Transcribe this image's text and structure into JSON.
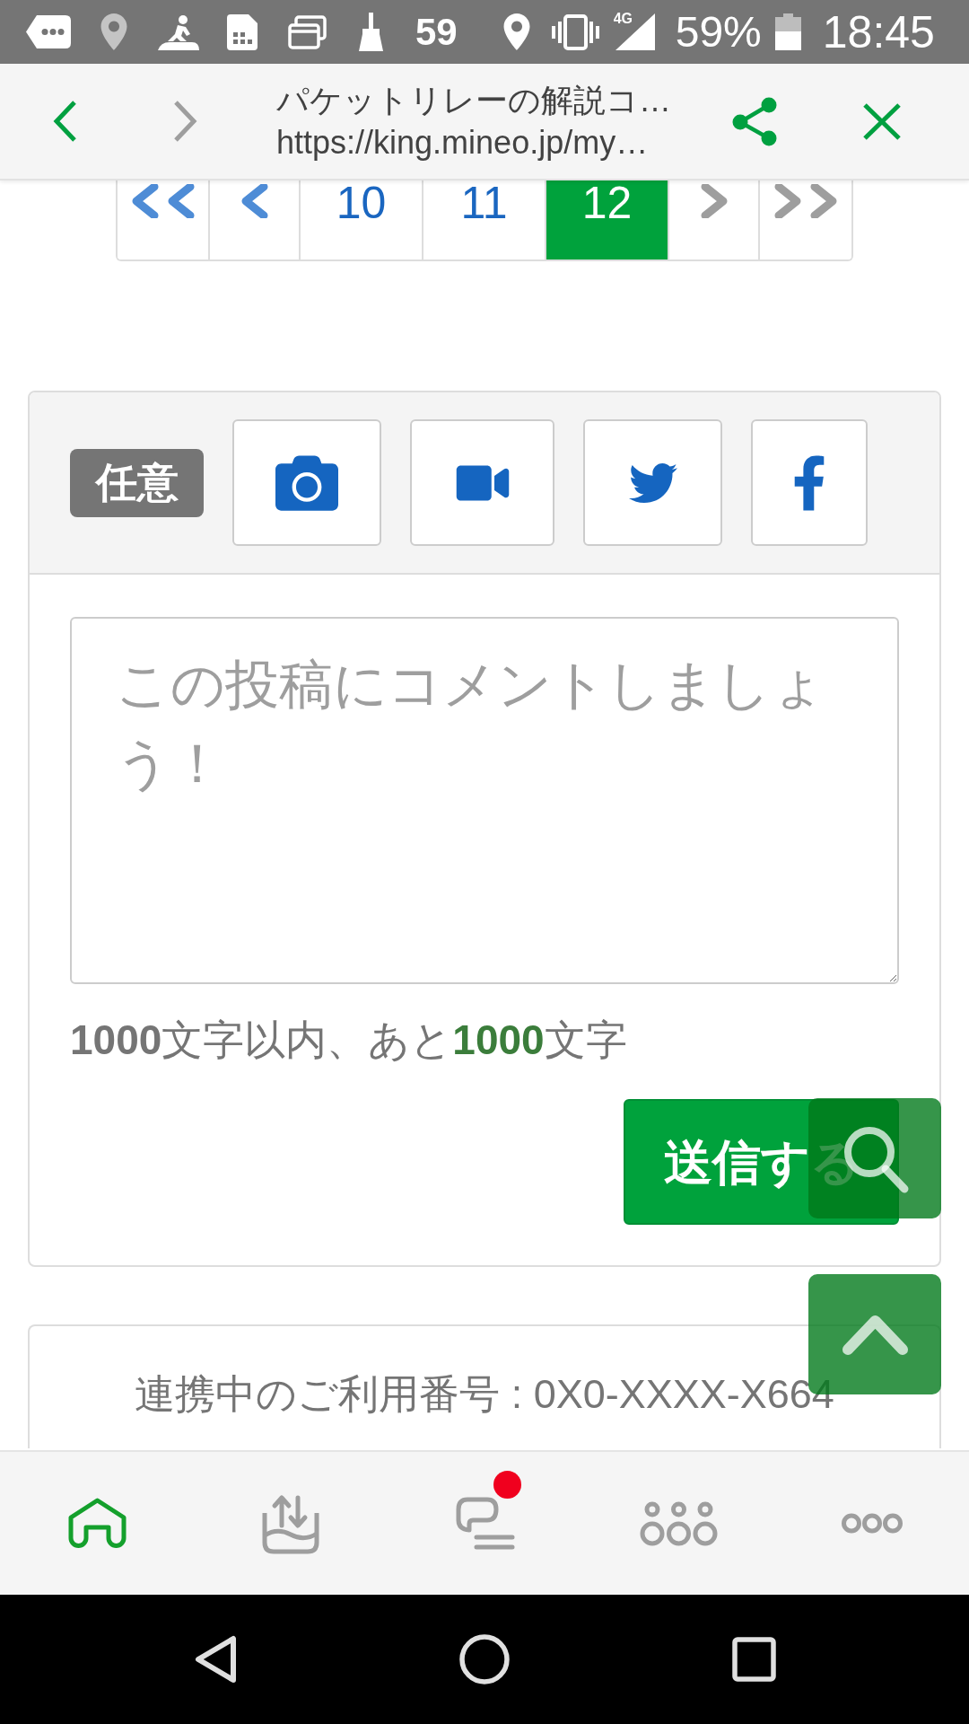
{
  "status_bar": {
    "notification_count": "59",
    "network_type": "4G",
    "battery_percent": "59%",
    "time": "18:45"
  },
  "browser_bar": {
    "nav": [
      {
        "kind": "back",
        "disabled": false
      },
      {
        "kind": "forward",
        "disabled": true
      }
    ],
    "title": "パケットリレーの解説コ…",
    "url": "https://king.mineo.jp/my…"
  },
  "pagination": [
    {
      "kind": "first",
      "disabled": false
    },
    {
      "kind": "prev",
      "disabled": false
    },
    {
      "kind": "page",
      "label": "10",
      "selected": false
    },
    {
      "kind": "page",
      "label": "11",
      "selected": false
    },
    {
      "kind": "page",
      "label": "12",
      "selected": true
    },
    {
      "kind": "next",
      "disabled": true
    },
    {
      "kind": "last",
      "disabled": true
    }
  ],
  "attachments": {
    "badge": "任意",
    "buttons": [
      {
        "kind": "camera"
      },
      {
        "kind": "video"
      },
      {
        "kind": "twitter"
      },
      {
        "kind": "facebook"
      }
    ]
  },
  "comment_form": {
    "placeholder": "この投稿にコメントしましょう！",
    "counter": {
      "limit": "1000",
      "limit_text": "文字以内、あと",
      "remaining": "1000",
      "remaining_text": "文字"
    },
    "submit": "送信する"
  },
  "linked_number": "連携中のご利用番号 : 0X0-XXXX-X664",
  "floating_buttons": [
    {
      "kind": "search"
    },
    {
      "kind": "scroll_top"
    }
  ],
  "bottom_nav": [
    {
      "kind": "home",
      "selected": true,
      "badge": false
    },
    {
      "kind": "transfer",
      "selected": false,
      "badge": false
    },
    {
      "kind": "chat",
      "selected": false,
      "badge": true
    },
    {
      "kind": "apps",
      "selected": false,
      "badge": false
    },
    {
      "kind": "more",
      "selected": false,
      "badge": false
    }
  ]
}
